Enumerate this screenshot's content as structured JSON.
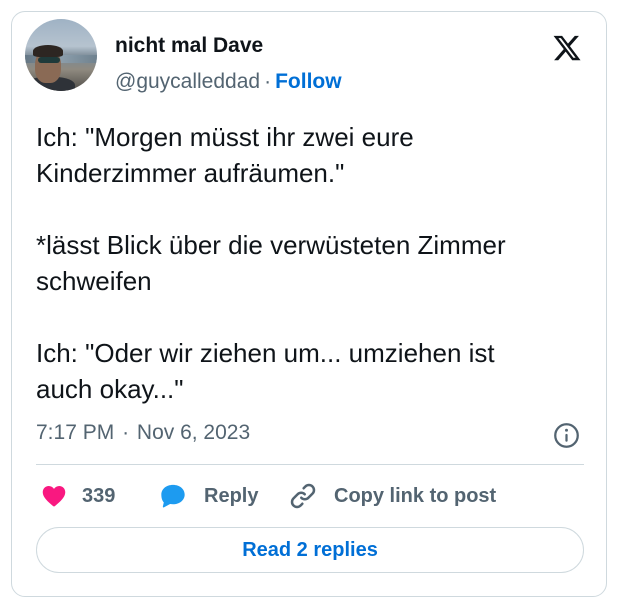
{
  "author": {
    "display_name": "nicht mal Dave",
    "handle": "@guycalleddad",
    "separator": "·",
    "follow_label": "Follow"
  },
  "tweet": {
    "lines": [
      "Ich: \"Morgen müsst ihr zwei eure",
      "Kinderzimmer aufräumen.\"",
      "",
      "*lässt Blick über die verwüsteten Zimmer",
      "schweifen",
      "",
      "Ich: \"Oder wir ziehen um... umziehen ist",
      "auch okay...\""
    ]
  },
  "meta": {
    "time": "7:17 PM",
    "separator": "·",
    "date": "Nov 6, 2023"
  },
  "actions": {
    "like_count": "339",
    "reply_label": "Reply",
    "copy_link_label": "Copy link to post"
  },
  "replies_button_label": "Read 2 replies",
  "icons": {
    "logo": "x-logo-icon",
    "avatar": "profile-photo",
    "info": "info-icon",
    "like": "heart-icon",
    "reply": "speech-bubble-icon",
    "copy_link": "link-icon"
  },
  "colors": {
    "link_blue": "#006fd6",
    "like_pink": "#f91880",
    "reply_blue": "#1d9bf0",
    "secondary_text": "#536471",
    "border": "#cfd9de"
  }
}
